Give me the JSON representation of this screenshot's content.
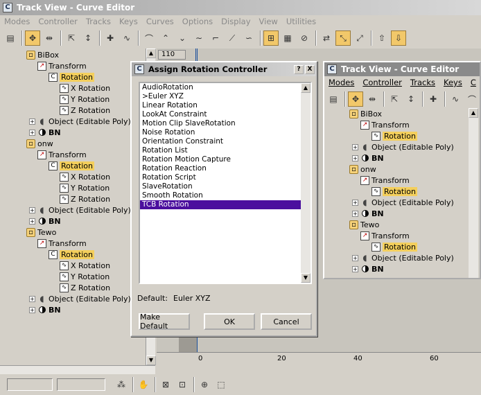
{
  "window": {
    "title": "Track View - Curve Editor",
    "icon": "C"
  },
  "menu": [
    "Modes",
    "Controller",
    "Tracks",
    "Keys",
    "Curves",
    "Options",
    "Display",
    "View",
    "Utilities"
  ],
  "timeline": {
    "frame": "110",
    "ruler": [
      "0",
      "20",
      "40",
      "60"
    ]
  },
  "tree": [
    {
      "label": "BiBox",
      "children": [
        {
          "label": "Transform",
          "sub": [
            {
              "label": "Rotation",
              "hl": true
            },
            {
              "label": "X Rotation"
            },
            {
              "label": "Y Rotation"
            },
            {
              "label": "Z Rotation"
            }
          ]
        },
        {
          "label": "Object (Editable Poly)"
        },
        {
          "label": "BN"
        }
      ]
    },
    {
      "label": "onw",
      "children": [
        {
          "label": "Transform",
          "sub": [
            {
              "label": "Rotation",
              "hl": true
            },
            {
              "label": "X Rotation"
            },
            {
              "label": "Y Rotation"
            },
            {
              "label": "Z Rotation"
            }
          ]
        },
        {
          "label": "Object (Editable Poly)"
        },
        {
          "label": "BN"
        }
      ]
    },
    {
      "label": "Tewo",
      "children": [
        {
          "label": "Transform",
          "sub": [
            {
              "label": "Rotation",
              "hl": true
            },
            {
              "label": "X Rotation"
            },
            {
              "label": "Y Rotation"
            },
            {
              "label": "Z Rotation"
            }
          ]
        },
        {
          "label": "Object (Editable Poly)"
        },
        {
          "label": "BN"
        }
      ]
    }
  ],
  "dialog": {
    "title": "Assign Rotation Controller",
    "help": "?",
    "close": "X",
    "items": [
      "AudioRotation",
      ">Euler XYZ",
      "Linear Rotation",
      "LookAt Constraint",
      "Motion Clip SlaveRotation",
      "Noise Rotation",
      "Orientation Constraint",
      "Rotation List",
      "Rotation Motion Capture",
      "Rotation Reaction",
      "Rotation Script",
      "SlaveRotation",
      "Smooth Rotation",
      "TCB Rotation"
    ],
    "selected": "TCB Rotation",
    "default_label": "Default:",
    "default_value": "Euler XYZ",
    "make_default": "Make Default",
    "ok": "OK",
    "cancel": "Cancel"
  },
  "window2": {
    "title": "Track View - Curve Editor",
    "menu": [
      "Modes",
      "Controller",
      "Tracks",
      "Keys",
      "C"
    ],
    "tree": [
      {
        "label": "BiBox",
        "transform": "Transform",
        "rotation": "Rotation",
        "object": "Object (Editable Poly)",
        "bn": "BN"
      },
      {
        "label": "onw",
        "transform": "Transform",
        "rotation": "Rotation",
        "object": "Object (Editable Poly)",
        "bn": "BN"
      },
      {
        "label": "Tewo",
        "transform": "Transform",
        "rotation": "Rotation",
        "object": "Object (Editable Poly)",
        "bn": "BN"
      }
    ]
  },
  "icons": [
    "filter-icon",
    "move-keys-icon",
    "slide-keys-icon",
    "scale-keys-icon",
    "scale-values-icon",
    "add-keys-icon",
    "draw-curves-icon",
    "tangent-icon",
    "snap-icon",
    "lock-icon",
    "hand-icon",
    "zoom-icon"
  ]
}
